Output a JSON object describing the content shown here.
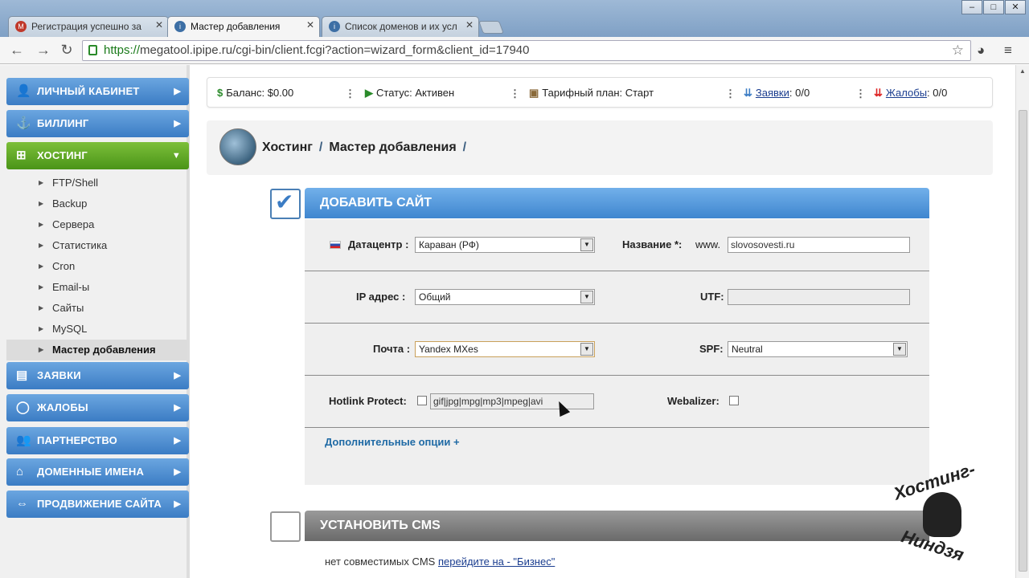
{
  "browser": {
    "tabs": [
      {
        "label": "Регистрация успешно за",
        "icon": "M",
        "color": "#c0392b"
      },
      {
        "label": "Мастер добавления",
        "icon": "i",
        "color": "#3d6fa5"
      },
      {
        "label": "Список доменов и их усл",
        "icon": "i",
        "color": "#3d6fa5"
      }
    ],
    "url_scheme": "https://",
    "url_rest": "megatool.ipipe.ru/cgi-bin/client.fcgi?action=wizard_form&client_id=17940",
    "window_buttons": [
      "–",
      "□",
      "✕"
    ],
    "back_icon": "←",
    "forward_icon": "→",
    "reload_icon": "↻",
    "star_icon": "☆",
    "extension_icon": "◕",
    "menu_icon": "≡"
  },
  "sidebar": {
    "top_items": [
      {
        "label": "ЛИЧНЫЙ КАБИНЕТ",
        "icon": "👤"
      },
      {
        "label": "БИЛЛИНГ",
        "icon": "⚓"
      },
      {
        "label": "ХОСТИНГ",
        "icon": "⊞"
      }
    ],
    "sub_items": [
      "FTP/Shell",
      "Backup",
      "Сервера",
      "Статистика",
      "Cron",
      "Email-ы",
      "Сайты",
      "MySQL",
      "Мастер добавления"
    ],
    "bottom_items": [
      {
        "label": "ЗАЯВКИ",
        "icon": "▤"
      },
      {
        "label": "ЖАЛОБЫ",
        "icon": "◯"
      },
      {
        "label": "ПАРТНЕРСТВО",
        "icon": "👥"
      },
      {
        "label": "ДОМЕННЫЕ ИМЕНА",
        "icon": "⌂"
      },
      {
        "label": "ПРОДВИЖЕНИЕ САЙТА",
        "icon": "⇔"
      }
    ],
    "arrow_right": "▶",
    "arrow_down": "▼",
    "bullet": "▶"
  },
  "status": {
    "balance_icon": "$",
    "balance": "Баланс: $0.00",
    "status_icon": "▶",
    "status": "Статус: Активен",
    "plan_icon": "▣",
    "plan": "Тарифный план: Старт",
    "requests_icon": "⇊",
    "requests_link": "Заявки",
    "requests_count": ": 0/0",
    "complaints_icon": "⇊",
    "complaints_link": "Жалобы",
    "complaints_count": ": 0/0",
    "separator": "⋮"
  },
  "breadcrumb": {
    "part1": "Хостинг",
    "slash": "/",
    "part2": "Мастер добавления",
    "slash2": "/"
  },
  "add_site": {
    "title": "ДОБАВИТЬ САЙТ",
    "check_icon": "✔",
    "datacenter_label": "Датацентр :",
    "datacenter_value": "Караван (РФ)",
    "name_label": "Название *:",
    "name_prefix": "www.",
    "name_value": "slovosovesti.ru",
    "ip_label": "IP адрес :",
    "ip_value": "Общий",
    "utf_label": "UTF:",
    "mail_label": "Почта :",
    "mail_value": "Yandex MXes",
    "spf_label": "SPF:",
    "spf_value": "Neutral",
    "hotlink_label": "Hotlink Protect:",
    "hotlink_value": "gif|jpg|mpg|mp3|mpeg|avi",
    "webalizer_label": "Webalizer:",
    "more_options": "Дополнительные опции +",
    "dropdown_icon": "▼"
  },
  "cms": {
    "title": "УСТАНОВИТЬ CMS",
    "text": "нет совместимых CMS",
    "link": "перейдите на - \"Бизнес\""
  },
  "watermark": {
    "line1": "Хостинг-",
    "line2": "Ниндзя"
  }
}
